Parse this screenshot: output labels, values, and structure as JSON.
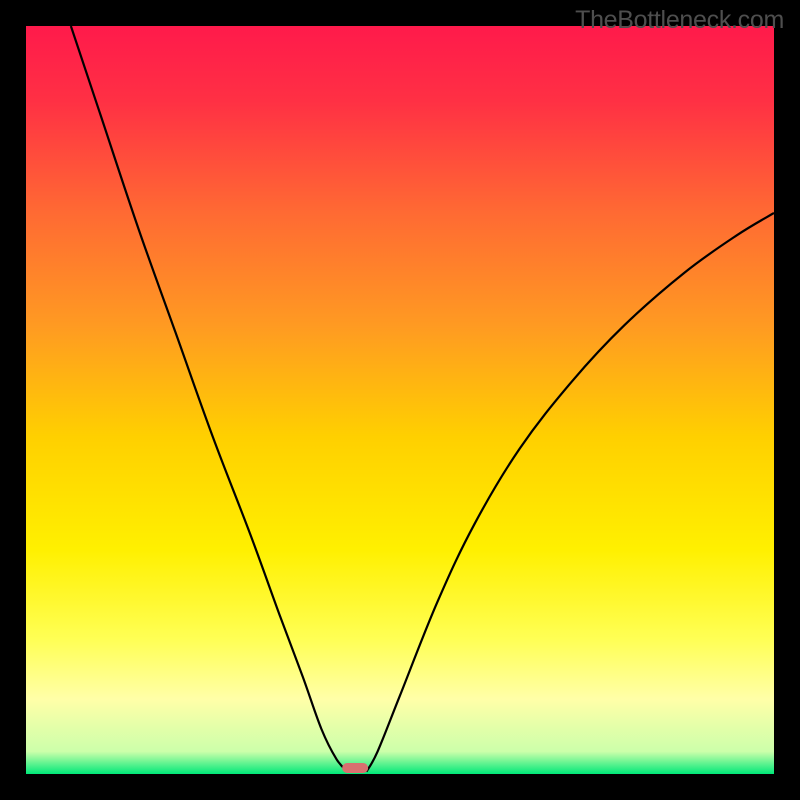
{
  "watermark": "TheBottleneck.com",
  "chart_data": {
    "type": "line",
    "title": "",
    "xlabel": "",
    "ylabel": "",
    "xlim": [
      0,
      100
    ],
    "ylim": [
      0,
      100
    ],
    "background_gradient": {
      "stops": [
        {
          "offset": 0.0,
          "color": "#ff1a4b"
        },
        {
          "offset": 0.1,
          "color": "#ff3044"
        },
        {
          "offset": 0.25,
          "color": "#ff6a33"
        },
        {
          "offset": 0.4,
          "color": "#ff9a22"
        },
        {
          "offset": 0.55,
          "color": "#ffd000"
        },
        {
          "offset": 0.7,
          "color": "#fff000"
        },
        {
          "offset": 0.82,
          "color": "#ffff55"
        },
        {
          "offset": 0.9,
          "color": "#ffffa8"
        },
        {
          "offset": 0.97,
          "color": "#ccffaa"
        },
        {
          "offset": 1.0,
          "color": "#00e879"
        }
      ]
    },
    "curve_left": {
      "description": "steep descending limb from top-left to minimum",
      "points": [
        {
          "x": 6.0,
          "y": 100.0
        },
        {
          "x": 10.0,
          "y": 88.0
        },
        {
          "x": 15.0,
          "y": 73.0
        },
        {
          "x": 20.0,
          "y": 59.0
        },
        {
          "x": 25.0,
          "y": 45.0
        },
        {
          "x": 30.0,
          "y": 32.0
        },
        {
          "x": 34.0,
          "y": 21.0
        },
        {
          "x": 37.0,
          "y": 13.0
        },
        {
          "x": 39.5,
          "y": 6.0
        },
        {
          "x": 41.5,
          "y": 2.0
        },
        {
          "x": 43.0,
          "y": 0.3
        }
      ]
    },
    "curve_right": {
      "description": "ascending limb from minimum toward upper-right",
      "points": [
        {
          "x": 45.5,
          "y": 0.3
        },
        {
          "x": 47.0,
          "y": 3.0
        },
        {
          "x": 50.0,
          "y": 10.5
        },
        {
          "x": 55.0,
          "y": 23.0
        },
        {
          "x": 60.0,
          "y": 33.5
        },
        {
          "x": 66.0,
          "y": 43.5
        },
        {
          "x": 73.0,
          "y": 52.5
        },
        {
          "x": 80.0,
          "y": 60.0
        },
        {
          "x": 88.0,
          "y": 67.0
        },
        {
          "x": 95.0,
          "y": 72.0
        },
        {
          "x": 100.0,
          "y": 75.0
        }
      ]
    },
    "minimum_marker": {
      "x": 44.0,
      "y": 0.0,
      "color": "#d9706f"
    }
  }
}
